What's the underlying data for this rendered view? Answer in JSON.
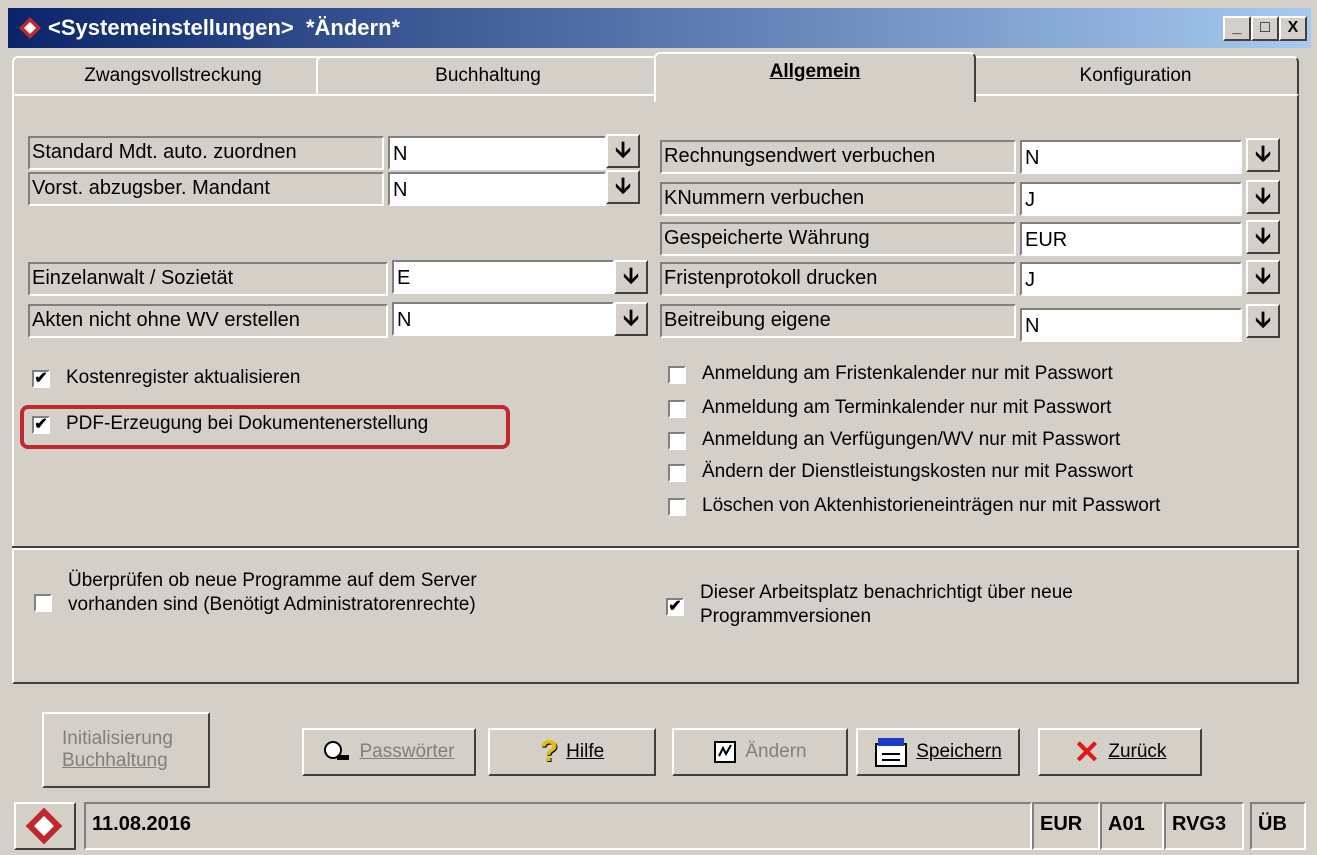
{
  "window": {
    "title": "<Systemeinstellungen>  *Ändern*",
    "minimize": "_",
    "maximize": "□",
    "close": "X"
  },
  "tabs": [
    {
      "label": "Zwangsvollstreckung"
    },
    {
      "label": "Buchhaltung"
    },
    {
      "label": "Allgemein",
      "active": true
    },
    {
      "label": "Konfiguration"
    }
  ],
  "left_fields": [
    {
      "label": "Standard Mdt. auto. zuordnen",
      "value": "N"
    },
    {
      "label": "Vorst. abzugsber. Mandant",
      "value": "N"
    },
    {
      "label": "Einzelanwalt / Sozietät",
      "value": "E"
    },
    {
      "label": "Akten nicht ohne WV erstellen",
      "value": "N"
    }
  ],
  "right_fields": [
    {
      "label": "Rechnungsendwert verbuchen",
      "value": "N"
    },
    {
      "label": "KNummern verbuchen",
      "value": "J"
    },
    {
      "label": "Gespeicherte Währung",
      "value": "EUR"
    },
    {
      "label": "Fristenprotokoll drucken",
      "value": "J"
    },
    {
      "label": "Beitreibung eigene",
      "value": "N"
    }
  ],
  "left_checks": [
    {
      "label": "Kostenregister aktualisieren",
      "checked": true
    },
    {
      "label": "PDF-Erzeugung bei Dokumentenerstellung",
      "checked": true
    }
  ],
  "right_checks": [
    {
      "label": "Anmeldung am Fristenkalender nur mit Passwort",
      "checked": false
    },
    {
      "label": "Anmeldung am Terminkalender nur mit Passwort",
      "checked": false
    },
    {
      "label": "Anmeldung an Verfügungen/WV nur mit Passwort",
      "checked": false
    },
    {
      "label": "Ändern der Dienstleistungskosten nur mit Passwort",
      "checked": false
    },
    {
      "label": "Löschen von Aktenhistorieneinträgen nur mit Passwort",
      "checked": false
    }
  ],
  "server_check": {
    "line1": "Überprüfen ob neue Programme auf dem Server",
    "line2": "vorhanden sind  (Benötigt Administratorenrechte)",
    "checked": false
  },
  "notify_check": {
    "line1": "Dieser Arbeitsplatz benachrichtigt über neue",
    "line2": "Programmversionen",
    "checked": true
  },
  "buttons": {
    "init_line1": "Initialisierung",
    "init_line2": "Buchhaltung",
    "passwords": "Passwörter",
    "help": "Hilfe",
    "change": "Ändern",
    "save": "Speichern",
    "back": "Zurück"
  },
  "status": {
    "date": "11.08.2016",
    "currency": "EUR",
    "code1": "A01",
    "code2": "RVG3",
    "code3": "ÜB"
  },
  "check_glyph": "✔",
  "dropdown_glyph": "🡫"
}
